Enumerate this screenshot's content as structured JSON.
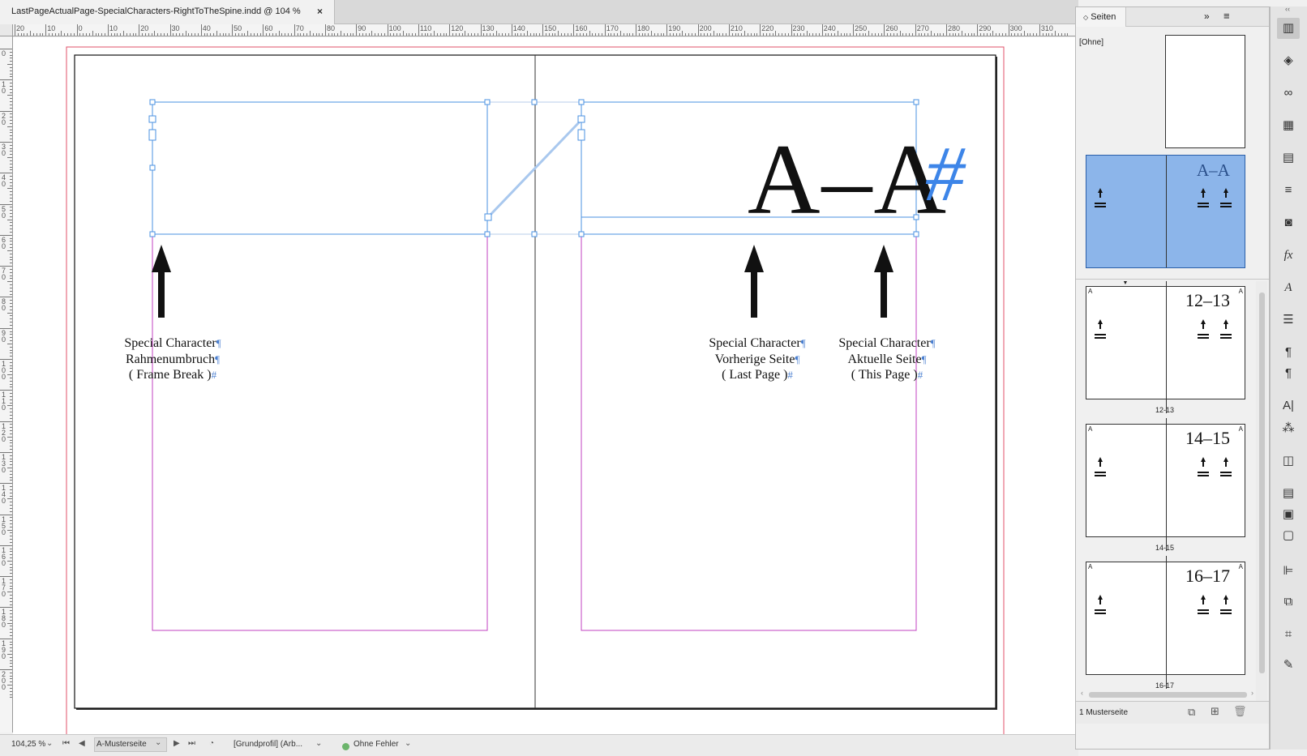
{
  "window": {
    "tab_title": "LastPageActualPage-SpecialCharacters-RightToTheSpine.indd @ 104 %",
    "tab_close": "×"
  },
  "ruler": {
    "h_labels": [
      "20",
      "10",
      "0",
      "10",
      "20",
      "30",
      "40",
      "50",
      "60",
      "70",
      "80",
      "90",
      "100",
      "110",
      "120",
      "130",
      "140",
      "150",
      "160",
      "170",
      "180",
      "190",
      "200",
      "210",
      "220",
      "230",
      "240",
      "250",
      "260",
      "270",
      "280",
      "290",
      "300",
      "310"
    ],
    "v_labels": [
      "0",
      "1\n0",
      "2\n0",
      "3\n0",
      "4\n0",
      "5\n0",
      "6\n0",
      "7\n0",
      "8\n0",
      "9\n0",
      "1\n0\n0",
      "1\n1\n0",
      "1\n2\n0",
      "1\n3\n0",
      "1\n4\n0",
      "1\n5\n0",
      "1\n6\n0",
      "1\n7\n0",
      "1\n8\n0",
      "1\n9\n0",
      "2\n0\n0"
    ]
  },
  "document": {
    "big_title": "A–A",
    "big_hash": "#",
    "labels": {
      "frame_break": {
        "line1": "Special Character",
        "line2": "Rahmenumbruch",
        "line3": "( Frame Break )",
        "end1": "¶",
        "end2": "¶",
        "end3": "#"
      },
      "last_page": {
        "line1": "Special Character",
        "line2": "Vorherige Seite",
        "line3": "( Last Page )",
        "end1": "¶",
        "end2": "¶",
        "end3": "#"
      },
      "this_page": {
        "line1": "Special Character",
        "line2": "Aktuelle Seite",
        "line3": "( This Page )",
        "end1": "¶",
        "end2": "¶",
        "end3": "#"
      }
    }
  },
  "statusbar": {
    "zoom": "104,25 %",
    "master_page": "A-Musterseite",
    "profile": "[Grundprofil] (Arb...",
    "preflight": "Ohne Fehler",
    "colors": {
      "ok": "#6cb56c"
    }
  },
  "pages_panel": {
    "tab_label": "Seiten",
    "none_master": "[Ohne]",
    "master_title": "A–A",
    "spreads": [
      {
        "number": "12–13",
        "caption": "12-13",
        "master_mark": "A"
      },
      {
        "number": "14–15",
        "caption": "14-15",
        "master_mark": "A"
      },
      {
        "number": "16–17",
        "caption": "16-17",
        "master_mark": "A"
      }
    ],
    "footer": "1 Musterseite"
  },
  "toolstrip": {
    "tools": [
      "pages-icon",
      "layers-icon",
      "links-icon",
      "swatches-icon",
      "gradient-icon",
      "stroke-icon",
      "cc-libraries-icon",
      "effects-icon",
      "character-styles-icon",
      "paragraph-icon",
      "paragraph-styles-icon",
      "paragraph-styles-2-icon",
      "character-icon",
      "glyphs-icon",
      "text-wrap-icon",
      "table-icon",
      "table-styles-icon",
      "cell-styles-icon",
      "align-icon",
      "pathfinder-icon",
      "transform-icon",
      "edit-icon"
    ]
  },
  "colors": {
    "accent": "#3d85e8",
    "margin": "#c040c0",
    "bleed": "#e0506a",
    "frame": "#4a90e2"
  }
}
